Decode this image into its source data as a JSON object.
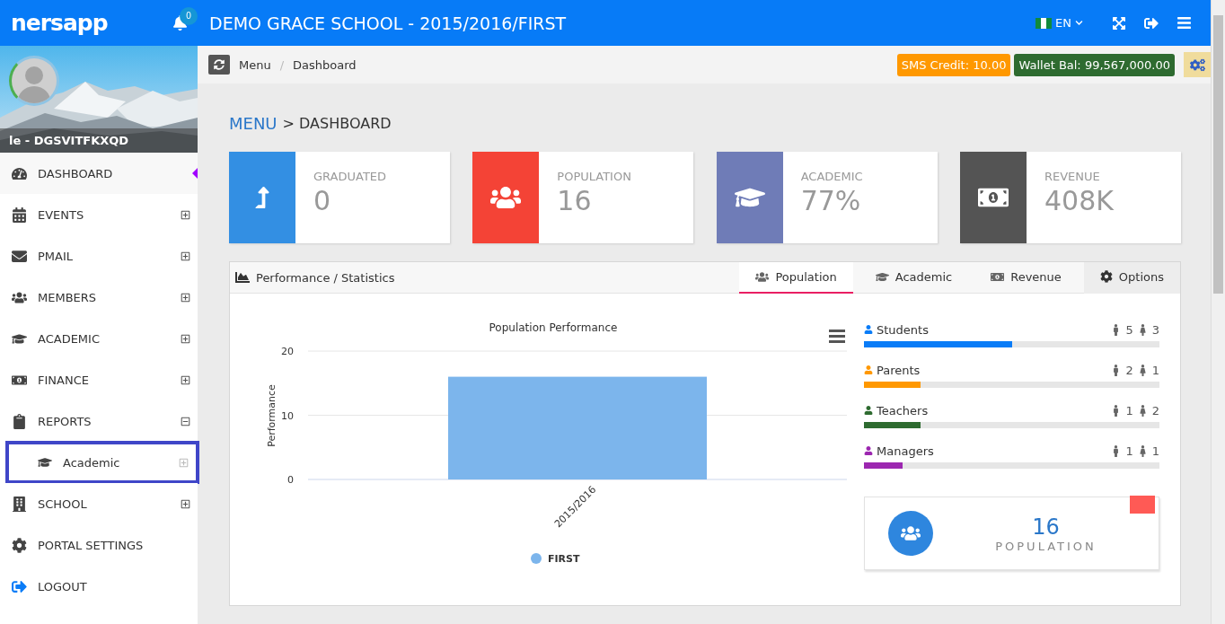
{
  "header": {
    "logo": "nersapp",
    "notifications": "0",
    "title": "DEMO GRACE SCHOOL - 2015/2016/FIRST",
    "language": "EN"
  },
  "profile": {
    "name": "le - DGSVITFKXQD"
  },
  "sidebar": {
    "items": [
      {
        "label": "DASHBOARD",
        "selected": true
      },
      {
        "label": "EVENTS",
        "expanded": false,
        "selected": false
      },
      {
        "label": "PMAIL",
        "expanded": false,
        "selected": false
      },
      {
        "label": "MEMBERS",
        "expanded": false,
        "selected": false
      },
      {
        "label": "ACADEMIC",
        "expanded": false,
        "selected": false
      },
      {
        "label": "FINANCE",
        "expanded": false,
        "selected": false
      },
      {
        "label": "REPORTS",
        "expanded": true,
        "selected": false,
        "children": [
          {
            "label": "Academic",
            "expanded": false,
            "selected": true
          }
        ]
      },
      {
        "label": "SCHOOL",
        "expanded": false,
        "selected": false
      },
      {
        "label": "PORTAL SETTINGS",
        "selected": false
      },
      {
        "label": "LOGOUT",
        "selected": false
      }
    ]
  },
  "breadcrumb": {
    "items": [
      "Menu",
      "Dashboard"
    ],
    "separator": "/"
  },
  "sms_credit": "SMS Credit: 10.00",
  "wallet": "Wallet Bal: 99,567,000.00",
  "heading": {
    "link": "MENU",
    "rest": "> DASHBOARD"
  },
  "stats": [
    {
      "label": "GRADUATED",
      "value": "0",
      "color": "#338fe3"
    },
    {
      "label": "POPULATION",
      "value": "16",
      "color": "#f44336"
    },
    {
      "label": "ACADEMIC",
      "value": "77%",
      "color": "#6f7cb7"
    },
    {
      "label": "REVENUE",
      "value": "408K",
      "color": "#545454"
    }
  ],
  "panel": {
    "title": "Performance / Statistics",
    "tabs": [
      {
        "label": "Population",
        "selected": true
      },
      {
        "label": "Academic",
        "selected": false
      },
      {
        "label": "Revenue",
        "selected": false
      },
      {
        "label": "Options",
        "selected": false
      }
    ],
    "chart_data": {
      "type": "bar",
      "title": "Population Performance",
      "ylabel": "Performance",
      "categories": [
        "2015/2016"
      ],
      "series": [
        {
          "name": "FIRST",
          "color": "#7cb5ec",
          "values": [
            16
          ]
        }
      ],
      "ylim": [
        0,
        20
      ],
      "yticks": [
        0,
        10,
        20
      ]
    },
    "groups": [
      {
        "name": "Students",
        "color": "#0a7cf7",
        "level": 0.5,
        "male": "5",
        "female": "3"
      },
      {
        "name": "Parents",
        "color": "#ff9800",
        "level": 0.19,
        "male": "2",
        "female": "1"
      },
      {
        "name": "Teachers",
        "color": "#2e6b30",
        "level": 0.19,
        "male": "1",
        "female": "2"
      },
      {
        "name": "Managers",
        "color": "#9c27b0",
        "level": 0.13,
        "male": "1",
        "female": "1"
      }
    ],
    "summary": {
      "value": "16",
      "label": "POPULATION"
    }
  }
}
